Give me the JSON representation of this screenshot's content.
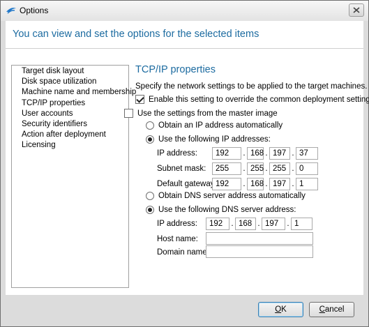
{
  "window": {
    "title": "Options",
    "header": "You can view and set the options for the selected items"
  },
  "nav": {
    "items": [
      {
        "label": "Target disk layout"
      },
      {
        "label": "Disk space utilization"
      },
      {
        "label": "Machine name and membership"
      },
      {
        "label": "TCP/IP properties"
      },
      {
        "label": "User accounts"
      },
      {
        "label": "Security identifiers"
      },
      {
        "label": "Action after deployment"
      },
      {
        "label": "Licensing"
      }
    ]
  },
  "tcpip": {
    "title": "TCP/IP properties",
    "description": "Specify the network settings to be applied to the target machines.",
    "override_label": "Enable this setting to override the common deployment setting",
    "override_checked": true,
    "master_label": "Use the settings from the master image",
    "master_checked": false,
    "obtain_ip_label": "Obtain an IP address automatically",
    "use_ip_label": "Use the following IP addresses:",
    "ip_address_label": "IP address:",
    "ip_address": [
      "192",
      "168",
      "197",
      "37"
    ],
    "subnet_mask_label": "Subnet mask:",
    "subnet_mask": [
      "255",
      "255",
      "255",
      "0"
    ],
    "gateway_label": "Default gateway:",
    "gateway": [
      "192",
      "168",
      "197",
      "1"
    ],
    "obtain_dns_label": "Obtain DNS server address automatically",
    "use_dns_label": "Use the following DNS server address:",
    "dns_ip_label": "IP address:",
    "dns_ip": [
      "192",
      "168",
      "197",
      "1"
    ],
    "host_name_label": "Host name:",
    "host_name": "",
    "domain_name_label": "Domain name:",
    "domain_name": ""
  },
  "buttons": {
    "ok": "OK",
    "cancel": "Cancel"
  },
  "colors": {
    "accent": "#1c6ba0"
  },
  "icons": {
    "app": "acronis-snapdeploy-icon",
    "close": "close-icon"
  }
}
